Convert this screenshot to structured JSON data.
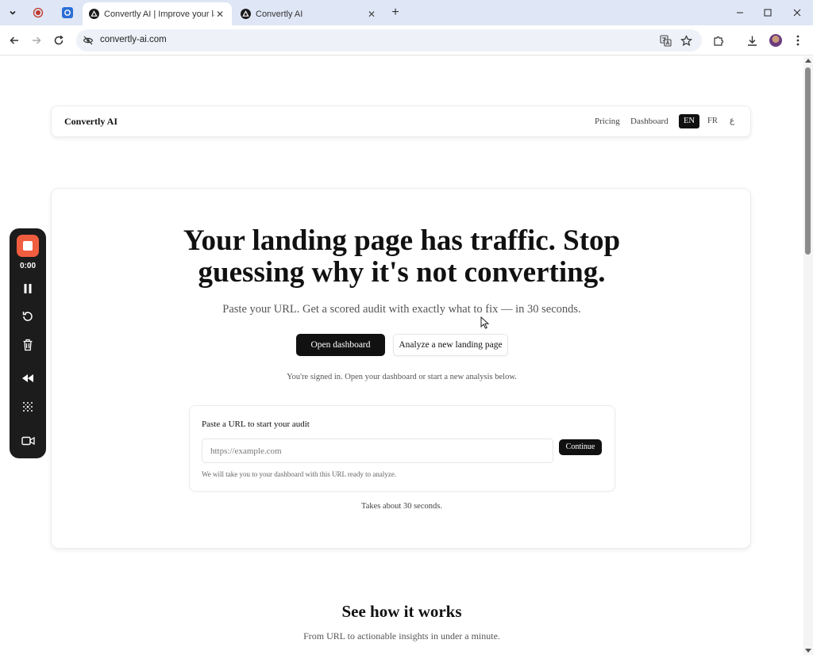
{
  "browser": {
    "tabs": [
      {
        "title": "Convertly AI | Improve your lan",
        "active": true
      },
      {
        "title": "Convertly AI",
        "active": false
      }
    ],
    "url": "convertly-ai.com"
  },
  "recorder": {
    "time": "0:00",
    "stop_color": "#f05d3f"
  },
  "site": {
    "brand": "Convertly AI",
    "nav": {
      "pricing": "Pricing",
      "dashboard": "Dashboard",
      "languages": [
        "EN",
        "FR",
        "ع"
      ],
      "active_language": "EN"
    },
    "hero": {
      "headline_line1": "Your landing page has traffic. Stop",
      "headline_line2": "guessing why it's not converting.",
      "subheadline": "Paste your URL. Get a scored audit with exactly what to fix — in 30 seconds.",
      "primary_button": "Open dashboard",
      "secondary_button": "Analyze a new landing page",
      "signed_in_note": "You're signed in. Open your dashboard or start a new analysis below.",
      "url_card": {
        "label": "Paste a URL to start your audit",
        "placeholder": "https://example.com",
        "value": "",
        "continue_button": "Continue",
        "hint": "We will take you to your dashboard with this URL ready to analyze."
      },
      "duration_note": "Takes about 30 seconds."
    },
    "how_it_works": {
      "title": "See how it works",
      "subtitle": "From URL to actionable insights in under a minute."
    }
  }
}
